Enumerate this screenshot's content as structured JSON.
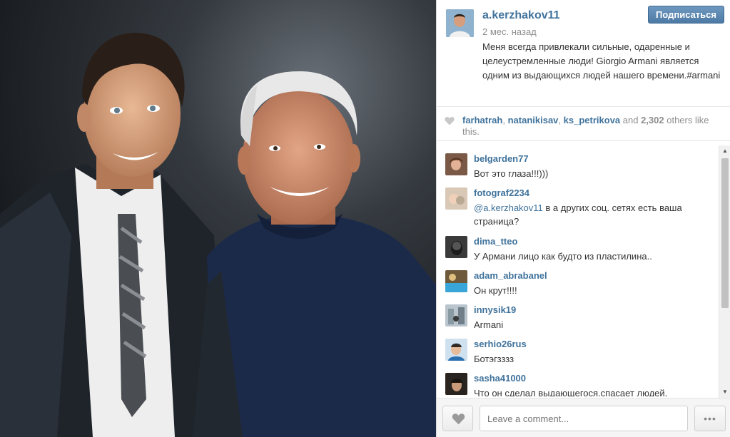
{
  "post": {
    "username": "a.kerzhakov11",
    "follow_label": "Подписаться",
    "timestamp": "2 мес. назад",
    "caption": "Меня всегда привлекали сильные, одаренные и целеустремленные люди! Giorgio Armani является одним из выдающихся людей нашего времени.#armani"
  },
  "likes": {
    "icon": "heart-icon",
    "users": [
      "farhatrah",
      "natanikisav",
      "ks_petrikova"
    ],
    "sep1": ", ",
    "sep2": ", ",
    "and_text": " and ",
    "count": "2,302",
    "suffix": " others like this."
  },
  "comments": [
    {
      "user": "belgarden77",
      "text": "Вот это глаза!!!)))"
    },
    {
      "user": "fotograf2234",
      "mention": "@a.kerzhakov11",
      "text": " в а других соц. сетях есть ваша страница?"
    },
    {
      "user": "dima_tteo",
      "text": "У Армани лицо как будто из пластилина.."
    },
    {
      "user": "adam_abrabanel",
      "text": "Он крут!!!!"
    },
    {
      "user": "innysik19",
      "text": "Armani"
    },
    {
      "user": "serhio26rus",
      "text": "Ботэгзззз"
    },
    {
      "user": "sasha41000",
      "text": "Что он сделал выдающегося,спасает людей,"
    }
  ],
  "footer": {
    "like_icon": "heart-icon",
    "comment_placeholder": "Leave a comment...",
    "more_label": "•••"
  },
  "colors": {
    "link": "#3f729b",
    "follow_button": "#4d7aa5"
  }
}
